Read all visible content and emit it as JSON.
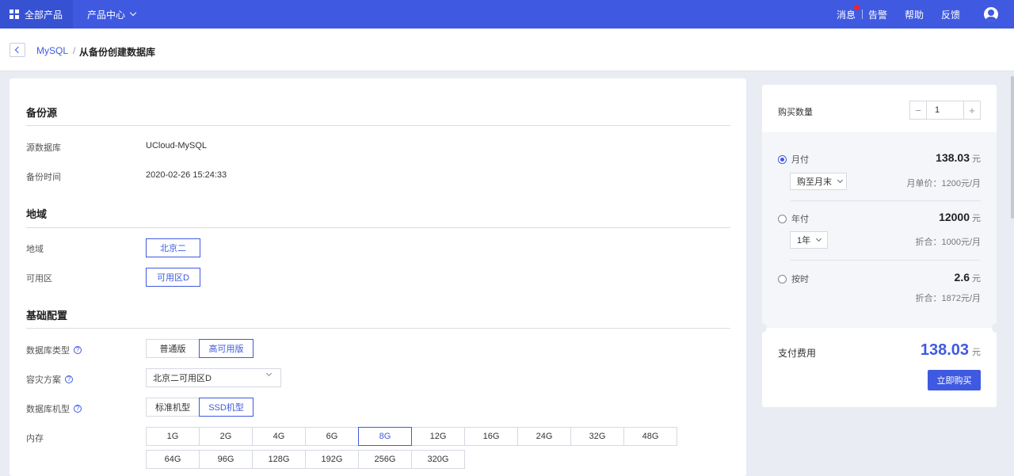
{
  "topbar": {
    "all_products": "全部产品",
    "product_center": "产品中心",
    "links": {
      "message": "消息",
      "alert": "告警",
      "help": "帮助",
      "feedback": "反馈"
    },
    "accent": "#3f5ae0"
  },
  "breadcrumb": {
    "parent": "MySQL",
    "separator": "/",
    "current": "从备份创建数据库"
  },
  "sections": {
    "backup_source": {
      "title": "备份源",
      "source_db_label": "源数据库",
      "source_db_value": "UCloud-MySQL",
      "backup_time_label": "备份时间",
      "backup_time_value": "2020-02-26 15:24:33"
    },
    "region": {
      "title": "地域",
      "region_label": "地域",
      "region_value": "北京二",
      "zone_label": "可用区",
      "zone_value": "可用区D"
    },
    "basic": {
      "title": "基础配置",
      "db_type_label": "数据库类型",
      "db_type_options": [
        "普通版",
        "高可用版"
      ],
      "db_type_selected": "高可用版",
      "dr_label": "容灾方案",
      "dr_value": "北京二可用区D",
      "machine_label": "数据库机型",
      "machine_options": [
        "标准机型",
        "SSD机型"
      ],
      "machine_selected": "SSD机型",
      "memory_label": "内存",
      "memory_options": [
        "1G",
        "2G",
        "4G",
        "6G",
        "8G",
        "12G",
        "16G",
        "24G",
        "32G",
        "48G",
        "64G",
        "96G",
        "128G",
        "192G",
        "256G",
        "320G"
      ],
      "memory_selected": "8G",
      "help_glyph": "?"
    }
  },
  "order": {
    "quantity_label": "购买数量",
    "quantity": "1",
    "minus": "−",
    "plus": "+",
    "monthly": {
      "label": "月付",
      "price": "138.03",
      "unit": "元",
      "period": "购至月末",
      "note": "月单价：1200元/月"
    },
    "yearly": {
      "label": "年付",
      "price": "12000",
      "unit": "元",
      "period": "1年",
      "note": "折合：1000元/月"
    },
    "hourly": {
      "label": "按时",
      "price": "2.6",
      "unit": "元",
      "note": "折合：1872元/月"
    },
    "pay_label": "支付费用",
    "pay_total": "138.03",
    "pay_unit": "元",
    "buy_button": "立即购买"
  }
}
